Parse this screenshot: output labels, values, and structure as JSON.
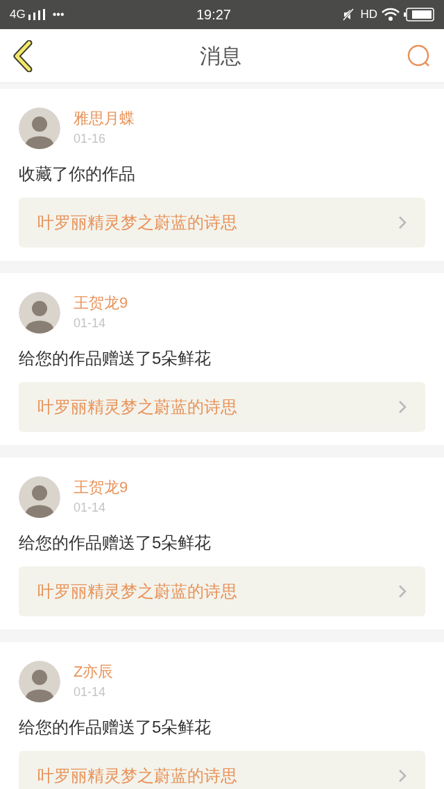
{
  "status_bar": {
    "network": "4G",
    "dots": "•••",
    "time": "19:27",
    "hd": "HD"
  },
  "header": {
    "title": "消息"
  },
  "messages": [
    {
      "user": "雅思月蝶",
      "date": "01-16",
      "text": "收藏了你的作品",
      "work": "叶罗丽精灵梦之蔚蓝的诗思"
    },
    {
      "user": "王贺龙9",
      "date": "01-14",
      "text": "给您的作品赠送了5朵鲜花",
      "work": "叶罗丽精灵梦之蔚蓝的诗思"
    },
    {
      "user": "王贺龙9",
      "date": "01-14",
      "text": "给您的作品赠送了5朵鲜花",
      "work": "叶罗丽精灵梦之蔚蓝的诗思"
    },
    {
      "user": "Z亦辰",
      "date": "01-14",
      "text": "给您的作品赠送了5朵鲜花",
      "work": "叶罗丽精灵梦之蔚蓝的诗思"
    }
  ]
}
